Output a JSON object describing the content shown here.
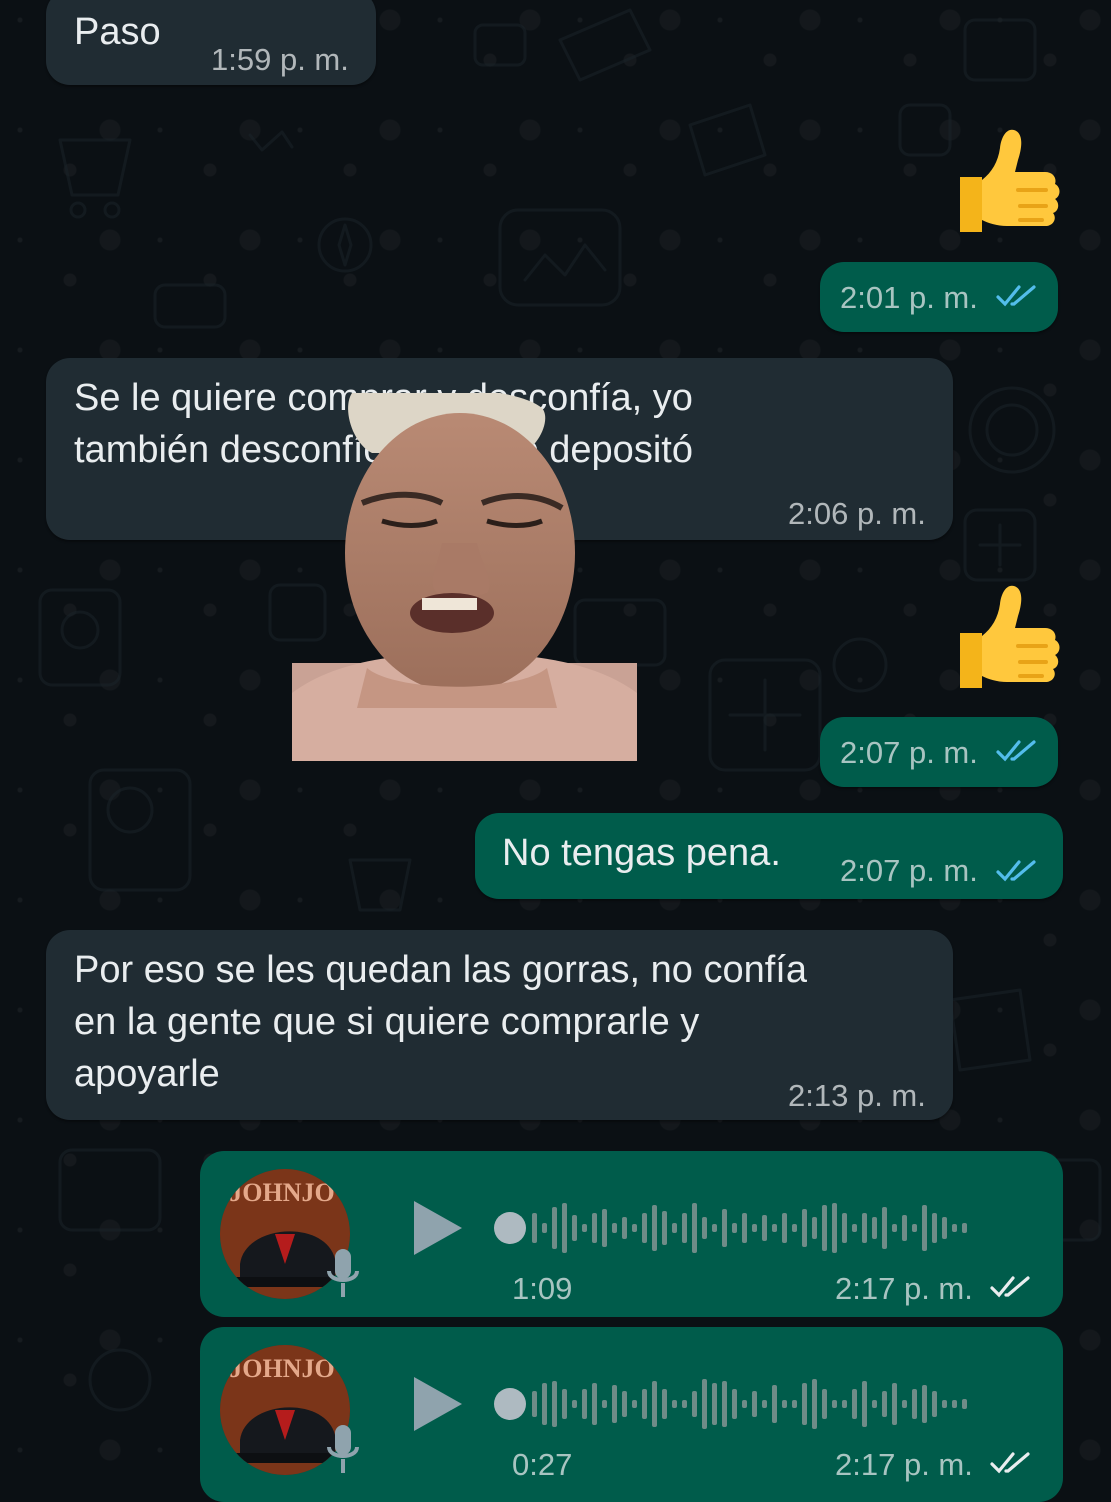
{
  "messages": [
    {
      "id": "m1",
      "direction": "incoming",
      "text": "Paso",
      "time": "1:59 p. m."
    },
    {
      "id": "m2",
      "direction": "outgoing",
      "emoji": "thumbs-up",
      "time": "2:01 p. m.",
      "status": "read"
    },
    {
      "id": "m3",
      "direction": "incoming",
      "text": "Se le quiere comprar y desconfía, yo\ntambién desconfío el previo depositó",
      "time": "2:06 p. m."
    },
    {
      "id": "m4",
      "direction": "outgoing",
      "emoji": "thumbs-up",
      "time": "2:07 p. m.",
      "status": "read"
    },
    {
      "id": "m5",
      "direction": "outgoing",
      "text": "No tengas pena.",
      "time": "2:07 p. m.",
      "status": "read"
    },
    {
      "id": "m6",
      "direction": "incoming",
      "text": "Por eso se les quedan las gorras, no confía\nen la gente que si quiere comprarle y\napoyarle",
      "time": "2:13 p. m."
    }
  ],
  "voice_notes": [
    {
      "id": "v1",
      "duration": "1:09",
      "time": "2:17 p. m.",
      "status": "delivered",
      "avatar_text": "JOHNJO",
      "avatar_icon": "cap-icon"
    },
    {
      "id": "v2",
      "duration": "0:27",
      "time": "2:17 p. m.",
      "status": "delivered",
      "avatar_text": "JOHNJO",
      "avatar_icon": "cap-icon"
    }
  ],
  "colors": {
    "background": "#0b1014",
    "incoming_bubble": "#202c33",
    "outgoing_bubble": "#005c4b",
    "read_ticks": "#53bdeb",
    "delivered_ticks": "#ffffff"
  }
}
